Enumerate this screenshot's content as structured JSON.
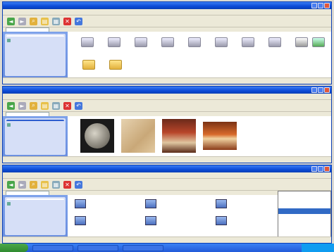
{
  "windows": [
    {
      "title": "",
      "status": "",
      "task_pane": {
        "header": "",
        "links": [
          "",
          ""
        ]
      }
    },
    {
      "title": "",
      "status": "",
      "task_pane": {
        "header": "",
        "links": [
          "",
          ""
        ]
      }
    },
    {
      "title": "",
      "status": "",
      "task_pane": {
        "header": "",
        "links": [
          "",
          "",
          ""
        ]
      }
    }
  ],
  "toolbar": {
    "back_icon": "back-arrow-icon",
    "search_icon": "search-icon",
    "folders_icon": "folders-icon",
    "move_icon": "move-to-icon",
    "copy_icon": "copy-to-icon",
    "delete_icon": "delete-icon",
    "undo_icon": "undo-icon",
    "views_icon": "views-icon"
  },
  "context_menu": {
    "items": [
      "",
      "",
      "",
      "",
      "",
      "",
      ""
    ],
    "selected_index": 3
  },
  "taskbar": {
    "start_label": "",
    "items": [
      "",
      "",
      ""
    ],
    "clock": ""
  },
  "colors": {
    "title_bar": "#0b4ad7",
    "task_pane": "#6b8fe0",
    "start_button": "#2f8a2f",
    "selection": "#316ac5"
  }
}
